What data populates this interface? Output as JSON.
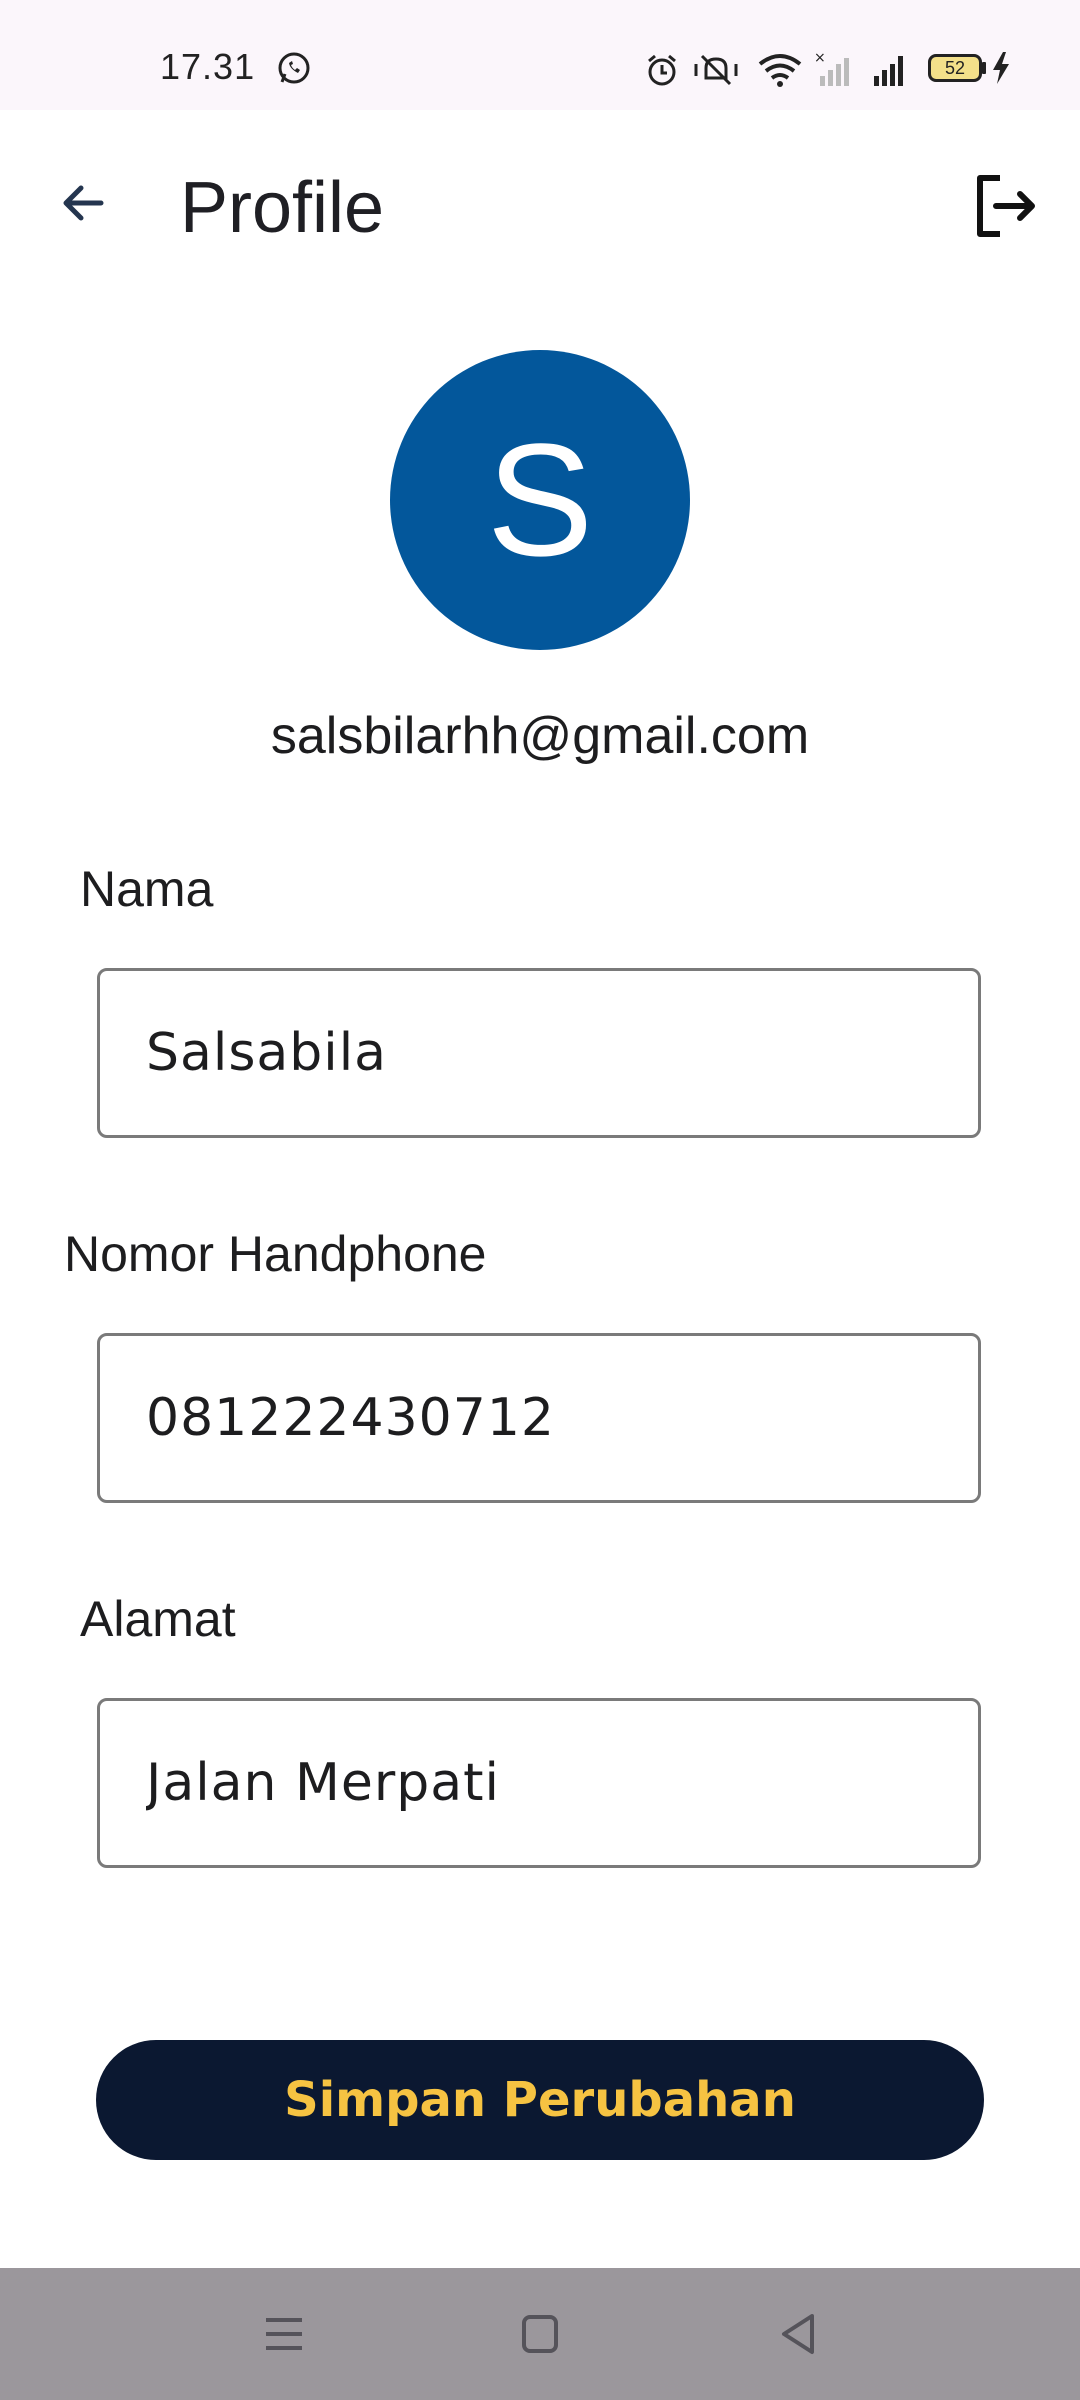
{
  "status_bar": {
    "time": "17.31",
    "battery": "52",
    "icons": [
      "whatsapp-icon",
      "alarm-icon",
      "mute-icon",
      "wifi-icon",
      "signal-x-icon",
      "signal-icon",
      "battery-icon",
      "charging-icon"
    ]
  },
  "app_bar": {
    "title": "Profile",
    "back_icon": "arrow-left-icon",
    "logout_icon": "logout-icon"
  },
  "profile": {
    "avatar_letter": "S",
    "avatar_color": "#03579b",
    "email": "salsbilarhh@gmail.com"
  },
  "form": {
    "name_label": "Nama",
    "name_value": "Salsabila",
    "phone_label": "Nomor Handphone",
    "phone_value": "081222430712",
    "address_label": "Alamat",
    "address_value": "Jalan Merpati"
  },
  "save_button": {
    "label": "Simpan Perubahan",
    "bg": "#0b1831",
    "text_color": "#f6c342"
  },
  "nav_bar": {
    "icons": [
      "menu-icon",
      "home-square-icon",
      "back-triangle-icon"
    ]
  }
}
